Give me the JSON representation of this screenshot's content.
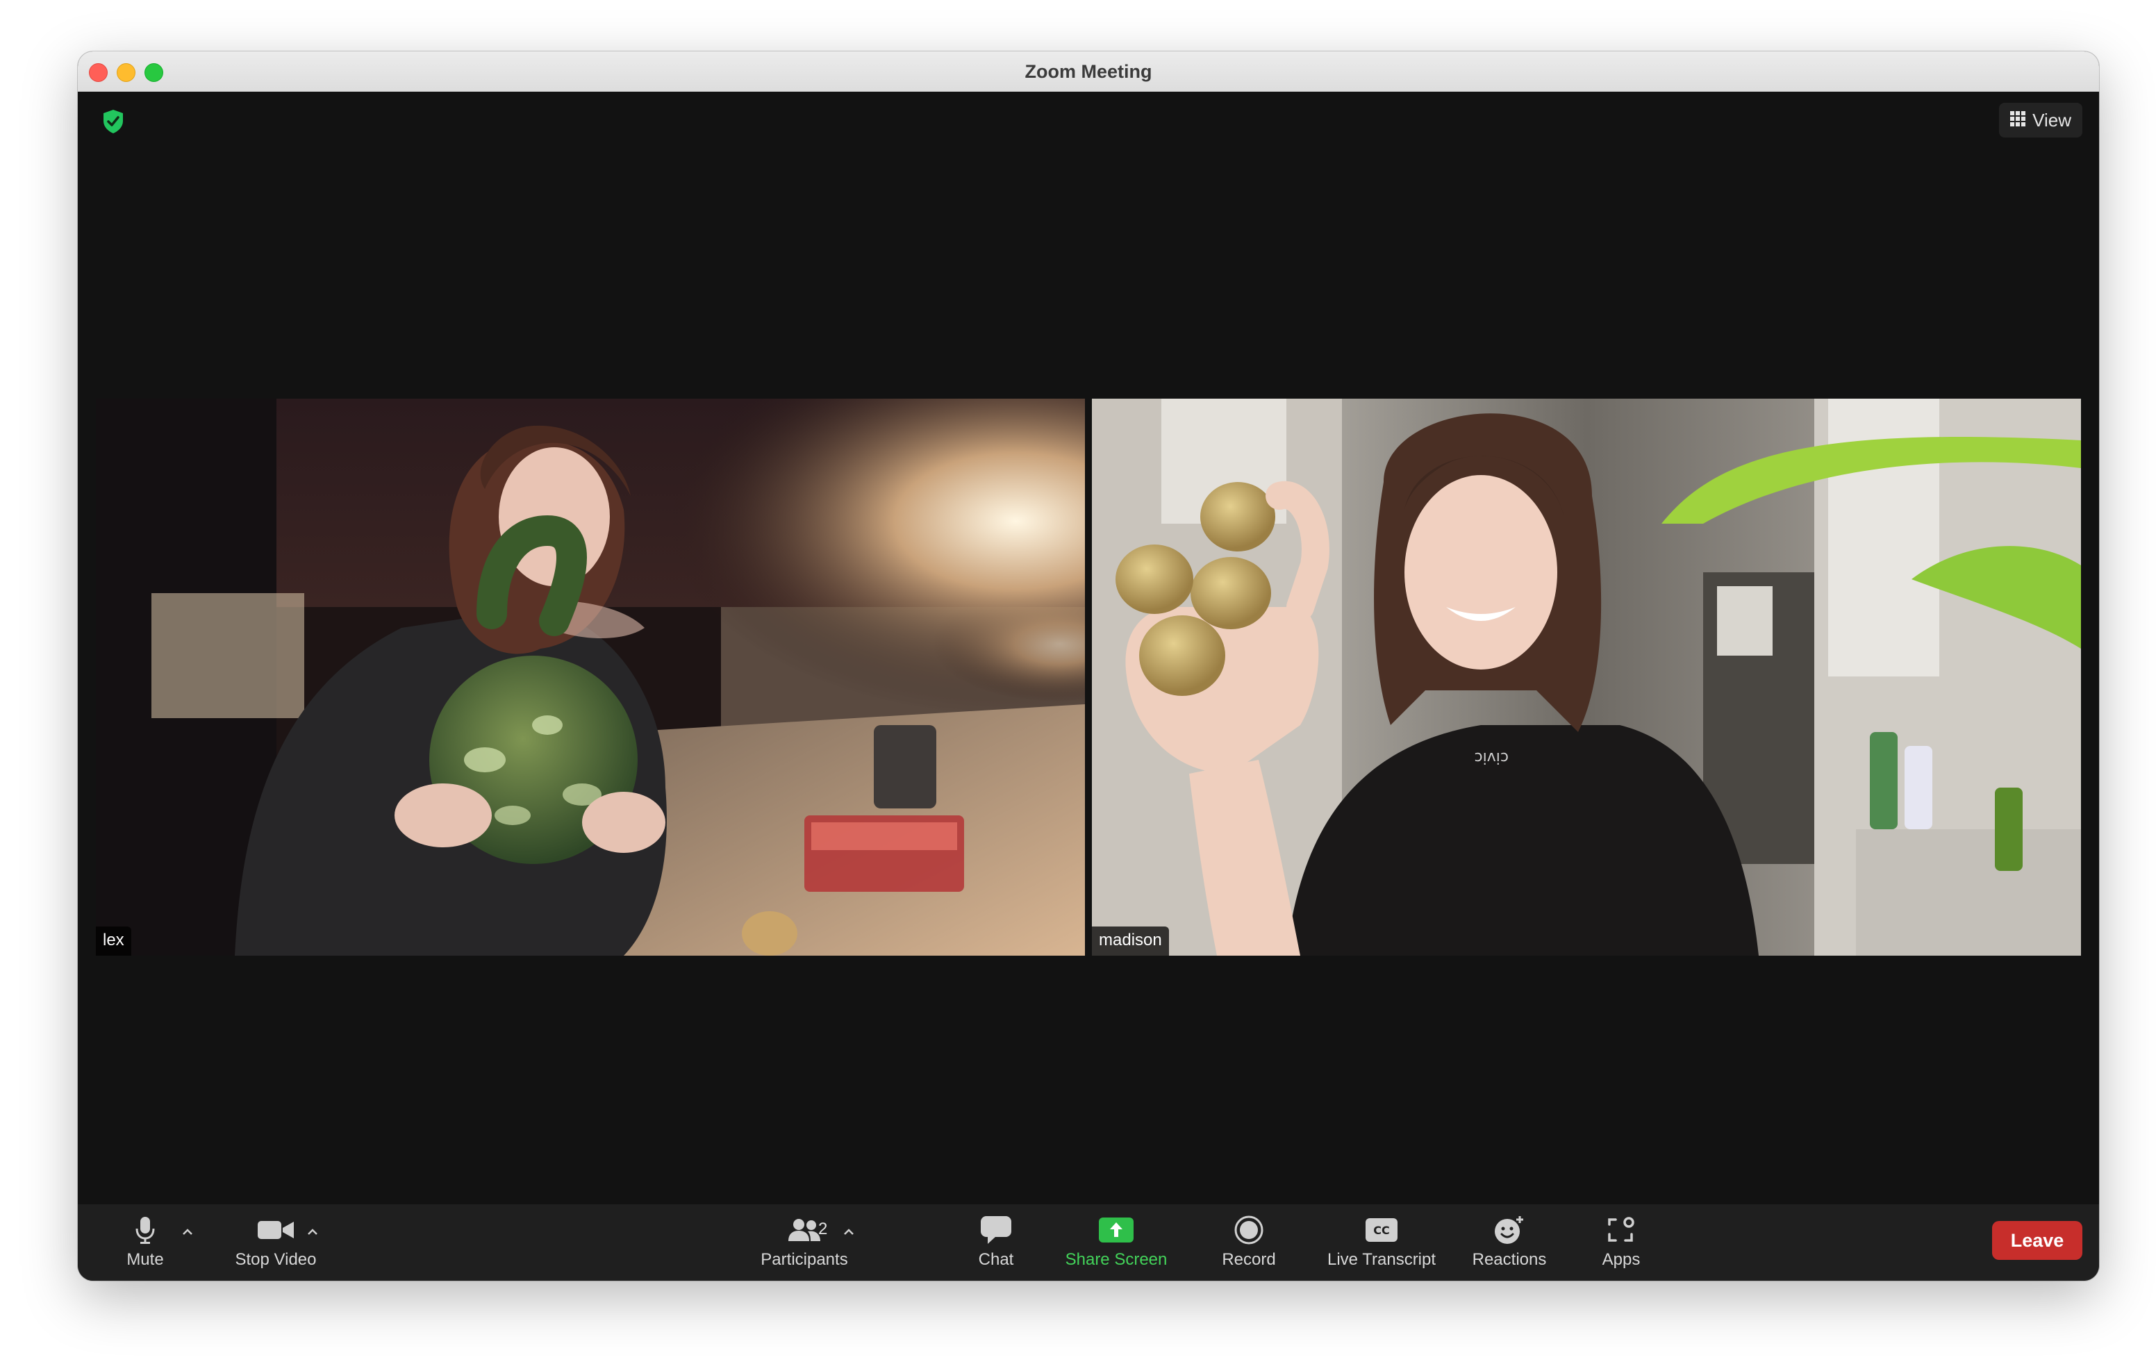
{
  "window": {
    "title": "Zoom Meeting"
  },
  "top_bar": {
    "view_label": "View"
  },
  "participants": [
    {
      "name": "lex"
    },
    {
      "name": "madison"
    }
  ],
  "toolbar": {
    "mute_label": "Mute",
    "stop_video_label": "Stop Video",
    "participants_label": "Participants",
    "participants_count": "2",
    "chat_label": "Chat",
    "share_screen_label": "Share Screen",
    "record_label": "Record",
    "live_transcript_label": "Live Transcript",
    "reactions_label": "Reactions",
    "apps_label": "Apps",
    "leave_label": "Leave"
  },
  "colors": {
    "share_accent": "#43d35a",
    "leave_red": "#c72e2b",
    "security_green": "#22c55e",
    "background": "#121212",
    "toolbar": "#1f1f1f"
  },
  "icons": {
    "security": "shield-check-icon",
    "view": "grid-icon",
    "mute": "microphone-icon",
    "stop_video": "video-camera-icon",
    "participants": "people-icon",
    "chat": "chat-bubble-icon",
    "share_screen": "share-screen-icon",
    "record": "record-icon",
    "live_transcript": "cc-icon",
    "reactions": "smiley-add-icon",
    "apps": "apps-icon",
    "caret": "chevron-up-icon"
  }
}
